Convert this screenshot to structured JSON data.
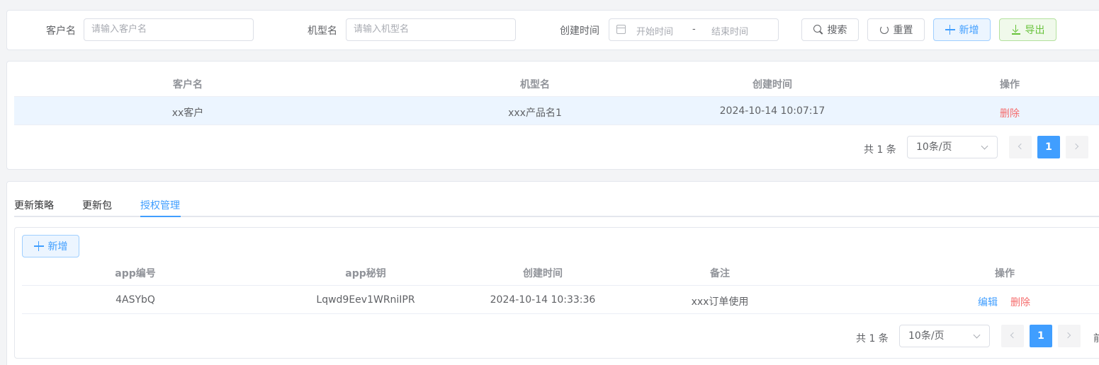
{
  "search": {
    "customer_label": "客户名",
    "customer_placeholder": "请输入客户名",
    "model_label": "机型名",
    "model_placeholder": "请输入机型名",
    "created_label": "创建时间",
    "start_placeholder": "开始时间",
    "range_sep": "-",
    "end_placeholder": "结束时间",
    "search_btn": "搜索",
    "reset_btn": "重置",
    "add_btn": "新增",
    "export_btn": "导出"
  },
  "table1": {
    "headers": [
      "客户名",
      "机型名",
      "创建时间",
      "操作"
    ],
    "rows": [
      {
        "customer": "xx客户",
        "model": "xxx产品名1",
        "created": "2024-10-14 10:07:17",
        "action_delete": "删除"
      }
    ],
    "pagination": {
      "total": "共 1 条",
      "page_size": "10条/页",
      "current": "1"
    }
  },
  "tabs": {
    "items": [
      "更新策略",
      "更新包",
      "授权管理"
    ],
    "active": "授权管理"
  },
  "table2": {
    "add_btn": "新增",
    "headers": [
      "app编号",
      "app秘钥",
      "创建时间",
      "备注",
      "操作"
    ],
    "rows": [
      {
        "app_id": "4ASYbQ",
        "app_secret": "Lqwd9Eev1WRniIPR",
        "created": "2024-10-14 10:33:36",
        "note": "xxx订单使用",
        "action_edit": "编辑",
        "action_delete": "删除"
      }
    ],
    "pagination": {
      "total": "共 1 条",
      "page_size": "10条/页",
      "current": "1",
      "trailing": "前"
    }
  },
  "colors": {
    "primary": "#409eff",
    "danger": "#f56c6c",
    "success": "#67c23a"
  }
}
